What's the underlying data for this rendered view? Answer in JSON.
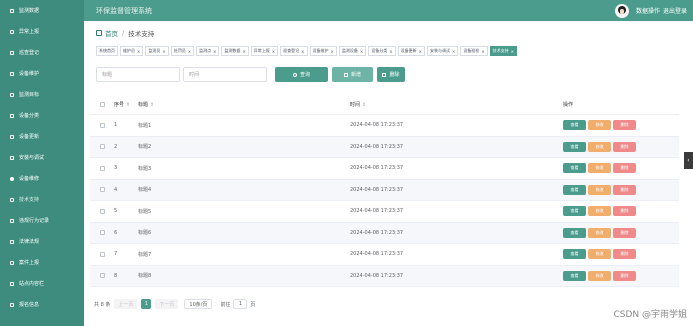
{
  "app_title": "环保监督管理系统",
  "header": {
    "username": "数据操作",
    "logout": "退出登录"
  },
  "sidebar": {
    "items": [
      {
        "label": "监测数据",
        "icon": "grid-icon"
      },
      {
        "label": "异常上报",
        "icon": "grid-icon"
      },
      {
        "label": "巡查登记",
        "icon": "grid-icon"
      },
      {
        "label": "设备维护",
        "icon": "grid-icon"
      },
      {
        "label": "监测目标",
        "icon": "grid-icon"
      },
      {
        "label": "设备分类",
        "icon": "grid-icon"
      },
      {
        "label": "设备更新",
        "icon": "grid-icon"
      },
      {
        "label": "安装与调试",
        "icon": "grid-icon"
      },
      {
        "label": "设备维修",
        "icon": "pin-icon"
      },
      {
        "label": "技术支持",
        "icon": "grid-icon"
      },
      {
        "label": "违规行为记录",
        "icon": "grid-icon"
      },
      {
        "label": "法律法规",
        "icon": "grid-icon"
      },
      {
        "label": "案件上报",
        "icon": "grid-icon"
      },
      {
        "label": "站点内容栏",
        "icon": "grid-icon"
      },
      {
        "label": "报名信息",
        "icon": "grid-icon"
      }
    ]
  },
  "breadcrumb": {
    "home": "首页",
    "current": "技术支持"
  },
  "tags": [
    "系统首页",
    "维护员",
    "监测员",
    "处罚员",
    "监测点",
    "监测数据",
    "异常上报",
    "巡查登记",
    "设备维护",
    "监测设备",
    "设备分类",
    "设备更新",
    "安装与调试",
    "设备巡检",
    "技术支持"
  ],
  "search": {
    "placeholder_1": "标题",
    "placeholder_2": "时间",
    "search_btn": "查询",
    "add_btn": "新增",
    "del_btn": "删除"
  },
  "table": {
    "headers": {
      "no": "序号",
      "title": "标题",
      "time": "时间",
      "ops": "操作"
    },
    "op_labels": {
      "view": "查看",
      "edit": "修改",
      "del": "删除"
    },
    "rows": [
      {
        "no": "1",
        "title": "标题1",
        "time": "2024-04-08 17:23:37"
      },
      {
        "no": "2",
        "title": "标题2",
        "time": "2024-04-08 17:23:37"
      },
      {
        "no": "3",
        "title": "标题3",
        "time": "2024-04-08 17:23:37"
      },
      {
        "no": "4",
        "title": "标题4",
        "time": "2024-04-08 17:23:37"
      },
      {
        "no": "5",
        "title": "标题5",
        "time": "2024-04-08 17:23:37"
      },
      {
        "no": "6",
        "title": "标题6",
        "time": "2024-04-08 17:23:37"
      },
      {
        "no": "7",
        "title": "标题7",
        "time": "2024-04-08 17:23:37"
      },
      {
        "no": "8",
        "title": "标题8",
        "time": "2024-04-08 17:23:37"
      }
    ]
  },
  "pager": {
    "total": "共 8 条",
    "prev": "上一页",
    "page": "1",
    "next": "下一页",
    "size": "10条/页",
    "goto": "前往",
    "page_input": "1",
    "page_unit": "页"
  },
  "watermark": "CSDN @宇雨学姐",
  "colors": {
    "primary": "#4c9c8d",
    "sidebar": "#3d8c7e",
    "edit": "#f0ad6c",
    "delete": "#f08a8a"
  }
}
